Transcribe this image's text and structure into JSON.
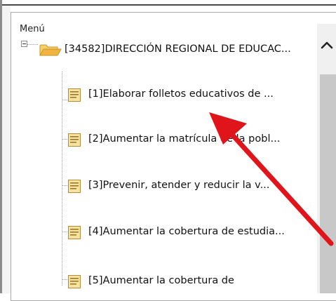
{
  "menu": {
    "label": "Menú"
  },
  "tree": {
    "root": {
      "label": "[34582]DIRECCIÓN REGIONAL DE EDUCAC...",
      "expanded": true,
      "icon": "folder-open-icon"
    },
    "items": [
      {
        "label": "[1]Elaborar folletos educativos de ...",
        "icon": "document-icon"
      },
      {
        "label": "[2]Aumentar la matrícula de la pobl...",
        "icon": "document-icon"
      },
      {
        "label": "[3]Prevenir, atender y reducir la v...",
        "icon": "document-icon"
      },
      {
        "label": "[4]Aumentar la cobertura de estudia...",
        "icon": "document-icon"
      },
      {
        "label": "[5]Aumentar la cobertura de",
        "icon": "document-icon"
      }
    ]
  },
  "annotation": {
    "type": "arrow",
    "color": "#e0151b"
  },
  "colors": {
    "folder": "#f2b441",
    "document": "#e8c86a",
    "scrollbar_track": "#c8c8c8"
  }
}
